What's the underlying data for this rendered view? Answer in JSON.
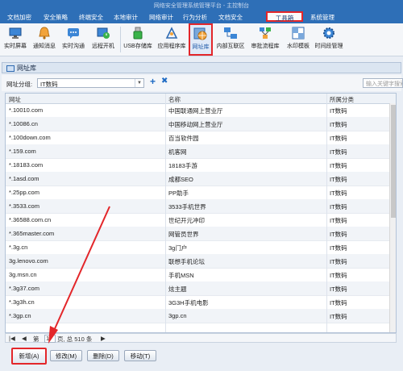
{
  "window": {
    "title": "网络安全管理系统管理平台 - 主控制台"
  },
  "menu": {
    "tabs": [
      {
        "label": "文档加密"
      },
      {
        "label": "安全策略"
      },
      {
        "label": "终端安全"
      },
      {
        "label": "本地审计"
      },
      {
        "label": "网络审计"
      },
      {
        "label": "行为分析"
      },
      {
        "label": "文档安全"
      },
      {
        "label": "工具箱"
      },
      {
        "label": "系统管理"
      }
    ],
    "active_index": 7
  },
  "toolbar": {
    "items": [
      {
        "label": "实时屏幕",
        "icon": "monitor-icon"
      },
      {
        "label": "通知消息",
        "icon": "bell-icon"
      },
      {
        "label": "实时沟通",
        "icon": "chat-icon"
      },
      {
        "label": "远程开机",
        "icon": "remote-power-icon"
      },
      {
        "label": "USB存储库",
        "icon": "usb-icon"
      },
      {
        "label": "应用程序库",
        "icon": "app-library-icon"
      },
      {
        "label": "网址库",
        "icon": "url-library-icon"
      },
      {
        "label": "内部互联区",
        "icon": "intranet-icon"
      },
      {
        "label": "审批流程库",
        "icon": "approval-icon"
      },
      {
        "label": "水印模板",
        "icon": "watermark-icon"
      },
      {
        "label": "时间段管理",
        "icon": "gear-icon"
      }
    ],
    "active_label": "网址库"
  },
  "panel": {
    "title": "网址库"
  },
  "filter": {
    "group_label": "网址分组:",
    "group_value": "IT数码",
    "search_placeholder": "输入关键字搜索"
  },
  "table": {
    "columns": [
      "网址",
      "名称",
      "所属分类"
    ],
    "rows": [
      [
        "*.10010.com",
        "中国联通网上营业厅",
        "IT数码"
      ],
      [
        "*.10086.cn",
        "中国移动网上营业厅",
        "IT数码"
      ],
      [
        "*.100down.com",
        "百当软件园",
        "IT数码"
      ],
      [
        "*.159.com",
        "机客网",
        "IT数码"
      ],
      [
        "*.18183.com",
        "18183手游",
        "IT数码"
      ],
      [
        "*.1asd.com",
        "成都SEO",
        "IT数码"
      ],
      [
        "*.25pp.com",
        "PP助手",
        "IT数码"
      ],
      [
        "*.3533.com",
        "3533手机世界",
        "IT数码"
      ],
      [
        "*.36588.com.cn",
        "世纪开元冲印",
        "IT数码"
      ],
      [
        "*.365master.com",
        "网管员世界",
        "IT数码"
      ],
      [
        "*.3g.cn",
        "3g门户",
        "IT数码"
      ],
      [
        "3g.lenovo.com",
        "联想手机论坛",
        "IT数码"
      ],
      [
        "3g.msn.cn",
        "手机MSN",
        "IT数码"
      ],
      [
        "*.3g37.com",
        "炫主题",
        "IT数码"
      ],
      [
        "*.3g3h.cn",
        "3G3H手机电影",
        "IT数码"
      ],
      [
        "*.3gp.cn",
        "3gp.cn",
        "IT数码"
      ]
    ]
  },
  "pager": {
    "text_before": "第",
    "page": "1",
    "text_after": "页, 总 510 条"
  },
  "buttons": {
    "add": "新增(A)",
    "edit": "修改(M)",
    "delete": "删除(D)",
    "move": "移动(T)"
  },
  "colors": {
    "titlebar": "#2e6fb7",
    "highlight": "#e3262a",
    "accent": "#1f6bc4"
  }
}
